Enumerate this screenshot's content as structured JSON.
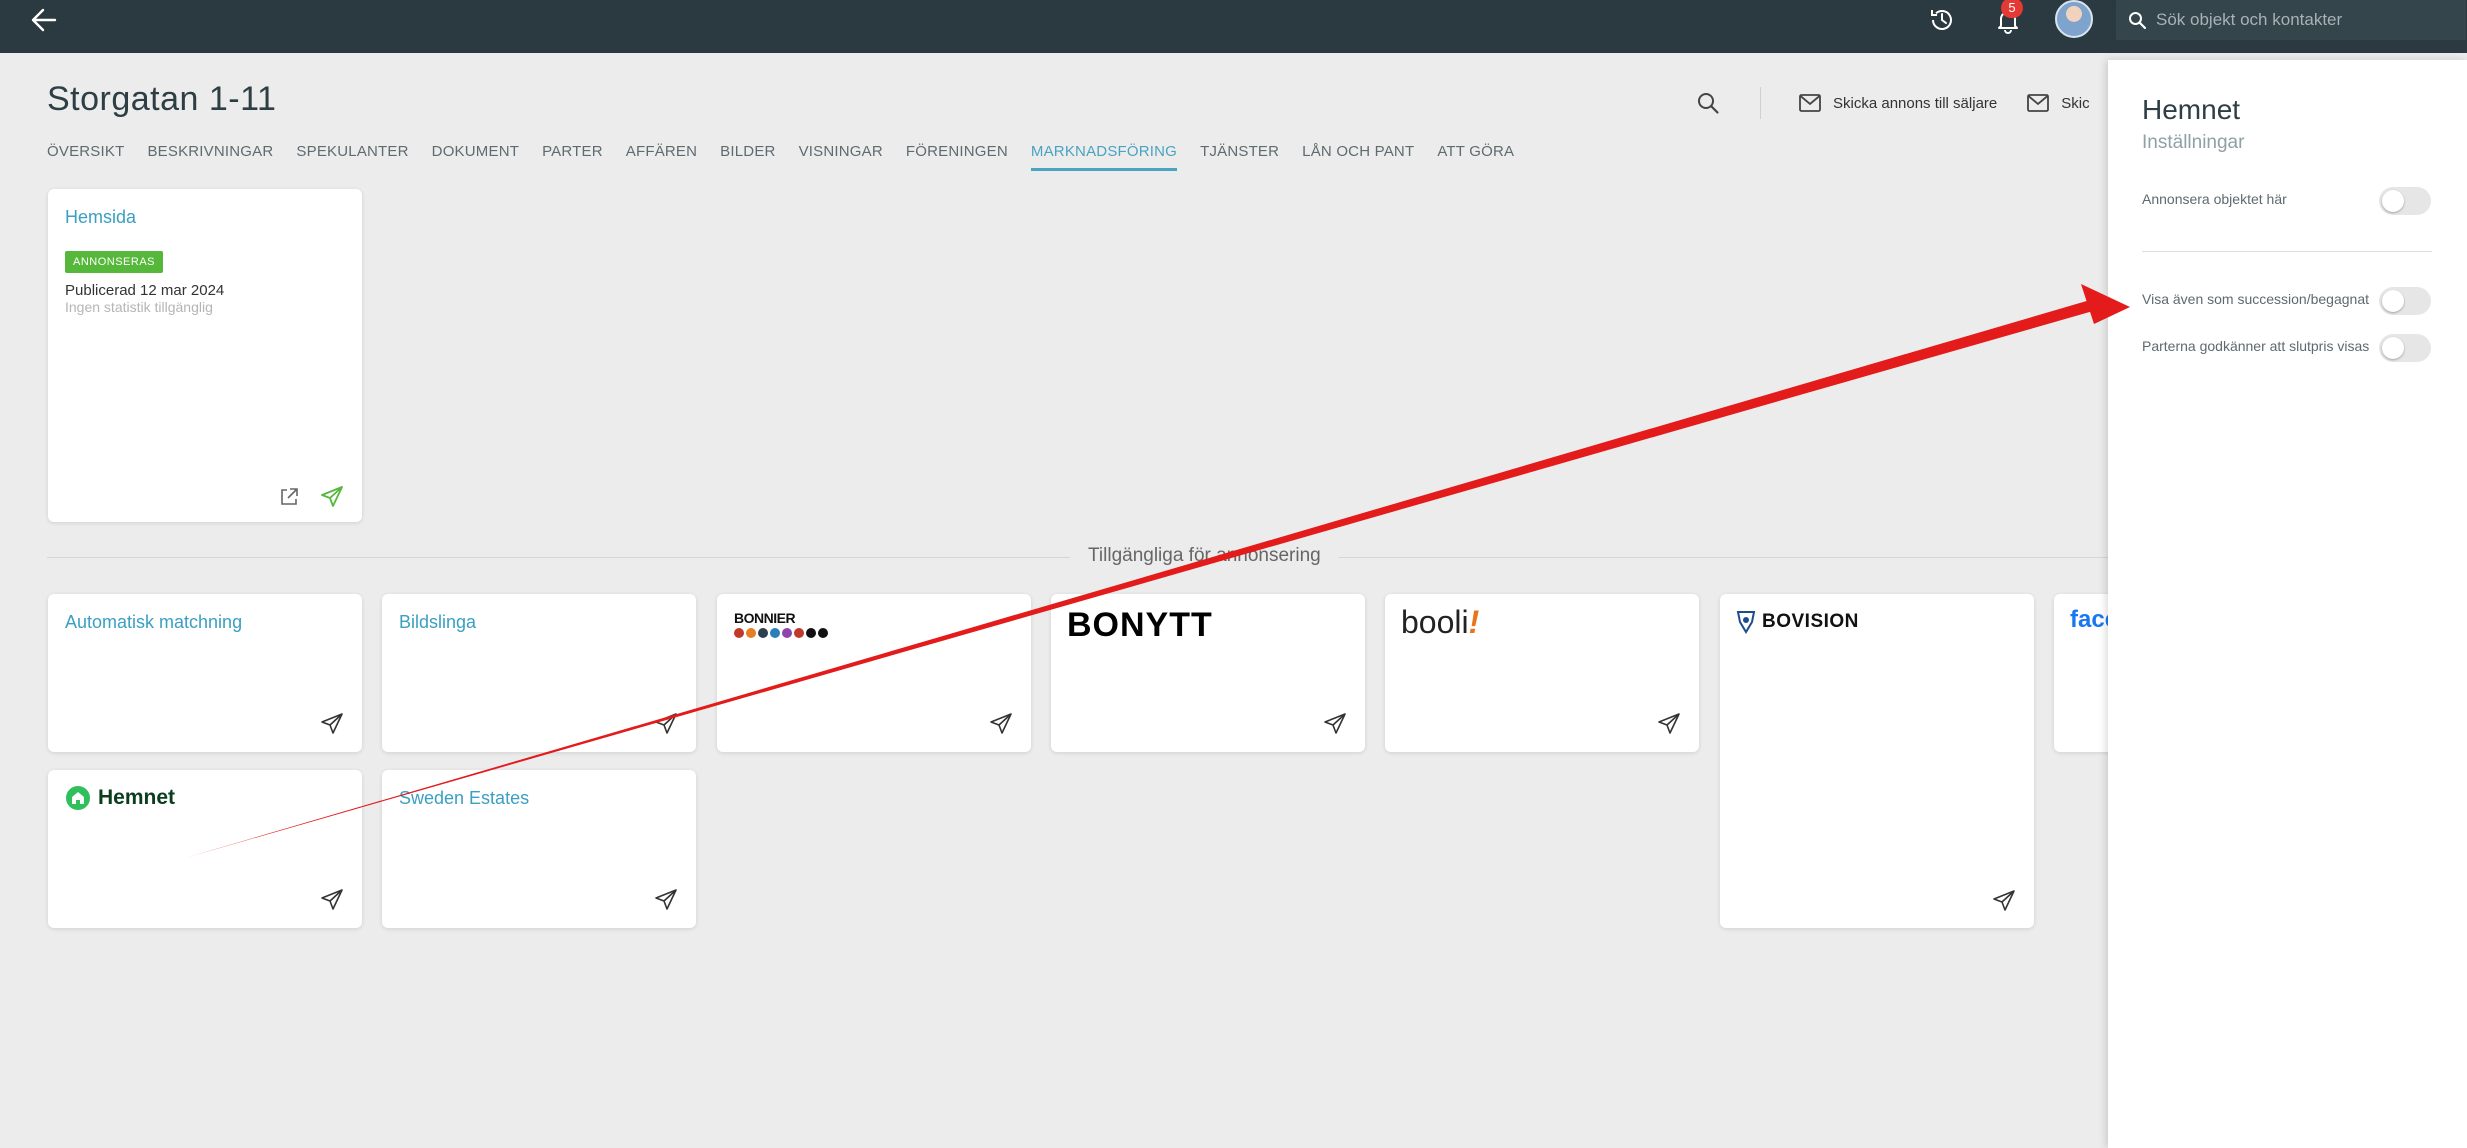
{
  "topbar": {
    "notification_count": "5",
    "search_placeholder": "Sök objekt och kontakter"
  },
  "page": {
    "title": "Storgatan 1-11"
  },
  "actions": {
    "send_to_seller": "Skicka annons till säljare",
    "send_partial": "Skic"
  },
  "tabs": [
    {
      "label": "ÖVERSIKT"
    },
    {
      "label": "BESKRIVNINGAR"
    },
    {
      "label": "SPEKULANTER"
    },
    {
      "label": "DOKUMENT"
    },
    {
      "label": "PARTER"
    },
    {
      "label": "AFFÄREN"
    },
    {
      "label": "BILDER"
    },
    {
      "label": "VISNINGAR"
    },
    {
      "label": "FÖRENINGEN"
    },
    {
      "label": "MARKNADSFÖRING",
      "active": true
    },
    {
      "label": "TJÄNSTER"
    },
    {
      "label": "LÅN OCH PANT"
    },
    {
      "label": "ATT GÖRA"
    }
  ],
  "published": {
    "title": "Hemsida",
    "badge": "ANNONSERAS",
    "published_text": "Publicerad 12 mar 2024",
    "stats_text": "Ingen statistik tillgänglig"
  },
  "available": {
    "heading": "Tillgängliga för annonsering",
    "channels": [
      {
        "title": "Automatisk matchning"
      },
      {
        "title": "Bildslinga"
      },
      {
        "logo_text": "BONNIER"
      },
      {
        "logo_text": "BONYTT"
      },
      {
        "logo_text": "booli",
        "logo_suffix": "!"
      },
      {
        "logo_text": "BOVISION"
      },
      {
        "logo_text": "face"
      },
      {
        "logo_text": "Hemnet"
      },
      {
        "title": "Sweden Estates"
      }
    ]
  },
  "panel": {
    "title": "Hemnet",
    "subtitle": "Inställningar",
    "settings": [
      {
        "label": "Annonsera objektet här",
        "on": false
      },
      {
        "label": "Visa även som succession/begagnat",
        "on": false
      },
      {
        "label": "Parterna godkänner att slutpris visas",
        "on": false
      }
    ]
  },
  "colors": {
    "topbar": "#2b3a40",
    "accent": "#4aa3c1",
    "badge_green": "#55b83a",
    "annotation_arrow": "#e31b1b"
  }
}
